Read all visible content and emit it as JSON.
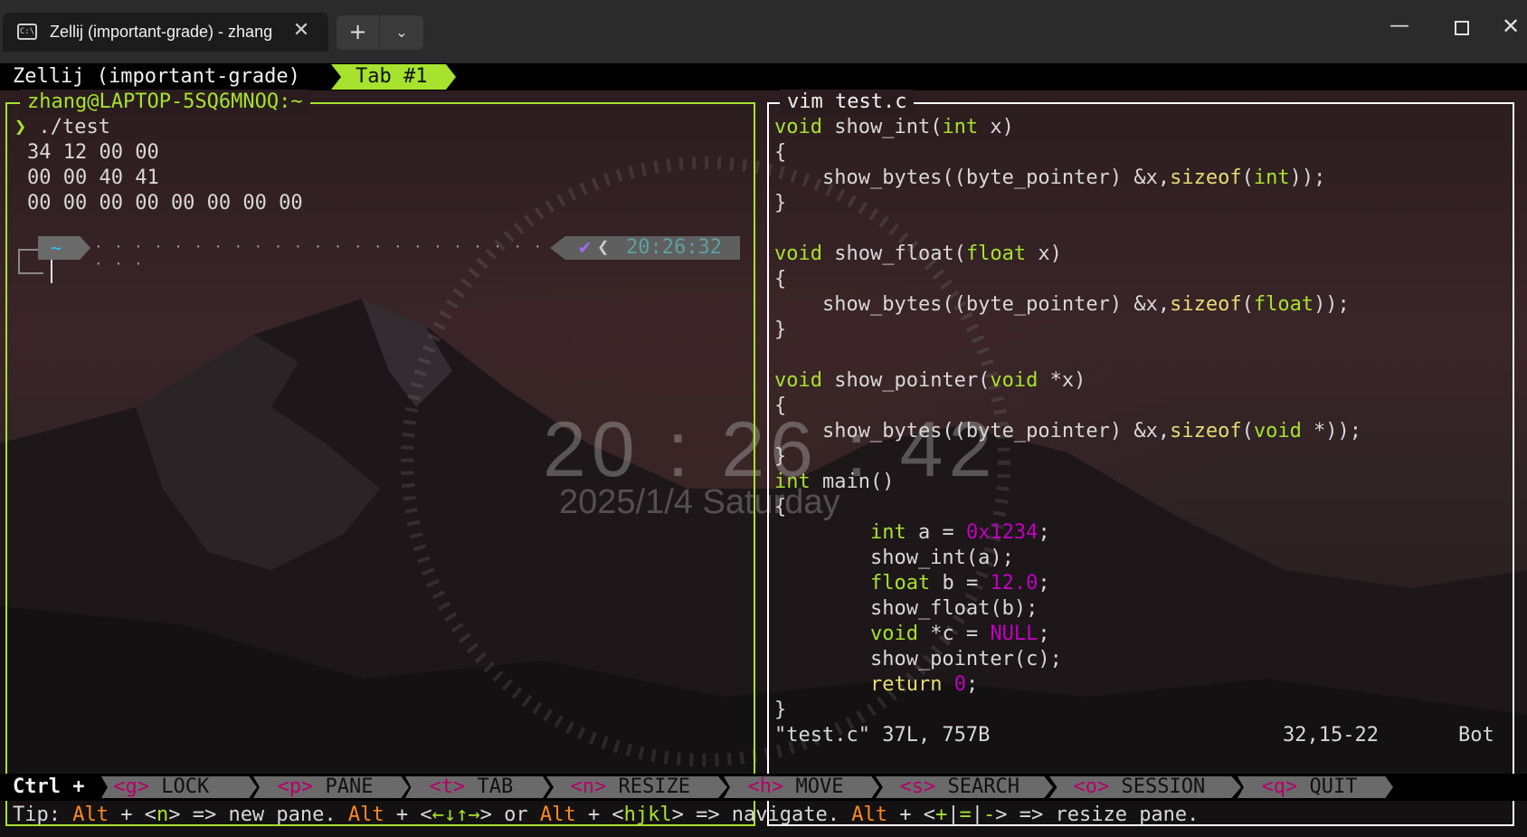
{
  "window": {
    "tab_title": "Zellij (important-grade) - zhang",
    "tab_icon": "C:\\",
    "close_glyph": "✕",
    "new_tab_glyph": "+",
    "dropdown_glyph": "⌄",
    "min_glyph": "—",
    "close_window_glyph": "✕"
  },
  "zellij": {
    "session": "Zellij (important-grade)",
    "tab": "Tab #1"
  },
  "left_pane": {
    "title": "zhang@LAPTOP-5SQ6MNOQ:~",
    "prompt_symbol": "❯",
    "command": "./test",
    "output": [
      "34 12 00 00",
      "00 00 40 41",
      "00 00 00 00 00 00 00 00"
    ],
    "prompt_dir": "~",
    "prompt_dots": "· · · · · · · · · · · · · · · · · · · · · · · · · · · · · · · · · · · ·",
    "status_check": "✔",
    "status_chevron": "❮",
    "time": "20:26:32"
  },
  "right_pane": {
    "title": "vim test.c",
    "status_file": "\"test.c\" 37L, 757B",
    "status_pos": "32,15-22",
    "status_scroll": "Bot"
  },
  "overlay": {
    "clock": "20 : 26 : 42",
    "date": "2025/1/4 Saturday"
  },
  "keybar": {
    "prefix": "Ctrl +",
    "keys": [
      {
        "key": "<g>",
        "label": "LOCK"
      },
      {
        "key": "<p>",
        "label": "PANE"
      },
      {
        "key": "<t>",
        "label": "TAB"
      },
      {
        "key": "<n>",
        "label": "RESIZE"
      },
      {
        "key": "<h>",
        "label": "MOVE"
      },
      {
        "key": "<s>",
        "label": "SEARCH"
      },
      {
        "key": "<o>",
        "label": "SESSION"
      },
      {
        "key": "<q>",
        "label": "QUIT"
      }
    ]
  },
  "tip": {
    "t1": "Tip: ",
    "alt": "Alt",
    "t2": " + <",
    "n": "n",
    "t3": "> => new pane. ",
    "t4": " + <",
    "arrows": "←↓↑→",
    "t5": "> or ",
    "t6": " + <",
    "hjkl": "hjkl",
    "t7": "> => navigate. ",
    "t8": " + <",
    "plus": "+",
    "bar1": "|",
    "eq": "=",
    "bar2": "|",
    "minus": "-",
    "t9": "> => resize pane."
  },
  "colors": {
    "accent_green": "#a6e22e",
    "function_yellow": "#e6db74",
    "number_magenta": "#c100c1",
    "tip_orange": "#ff8a1d"
  }
}
